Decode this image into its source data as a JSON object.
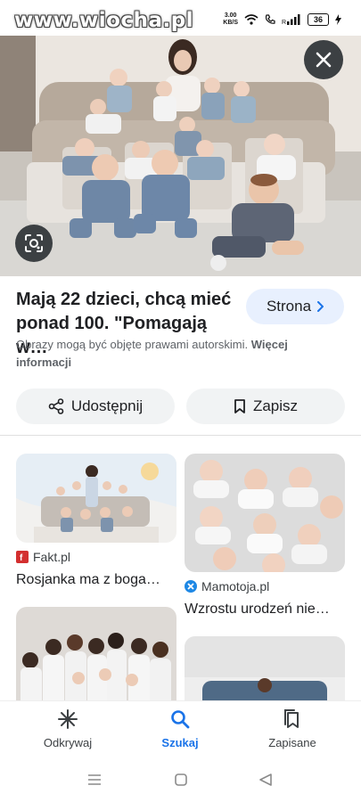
{
  "status_bar": {
    "watermark": "www.wiocha.pl",
    "net_speed_value": "3.00",
    "net_speed_unit": "KB/S",
    "signal_label": "R",
    "battery": "36"
  },
  "hero": {
    "close_icon": "close-icon",
    "lens_icon": "lens-icon"
  },
  "result": {
    "title": "Mają 22 dzieci, chcą mieć ponad 100. \"Pomagają w…",
    "visit_label": "Strona",
    "copyright_text": "Obrazy mogą być objęte prawami autorskimi.",
    "more_info": "Więcej informacji"
  },
  "actions": {
    "share_label": "Udostępnij",
    "save_label": "Zapisz"
  },
  "related": [
    {
      "source": "Fakt.pl",
      "title": "Rosjanka ma z boga…",
      "favicon_color": "#d32f2f"
    },
    {
      "source": "Mamotoja.pl",
      "title": "Wzrostu urodzeń nie…",
      "favicon_color": "#1e88e5"
    }
  ],
  "bottom_nav": [
    {
      "label": "Odkrywaj",
      "icon": "asterisk-icon",
      "active": false
    },
    {
      "label": "Szukaj",
      "icon": "search-icon",
      "active": true
    },
    {
      "label": "Zapisane",
      "icon": "bookmarks-icon",
      "active": false
    }
  ],
  "colors": {
    "accent": "#1a73e8",
    "chip_bg": "#f1f3f4",
    "visit_bg": "#e8f0fe"
  }
}
